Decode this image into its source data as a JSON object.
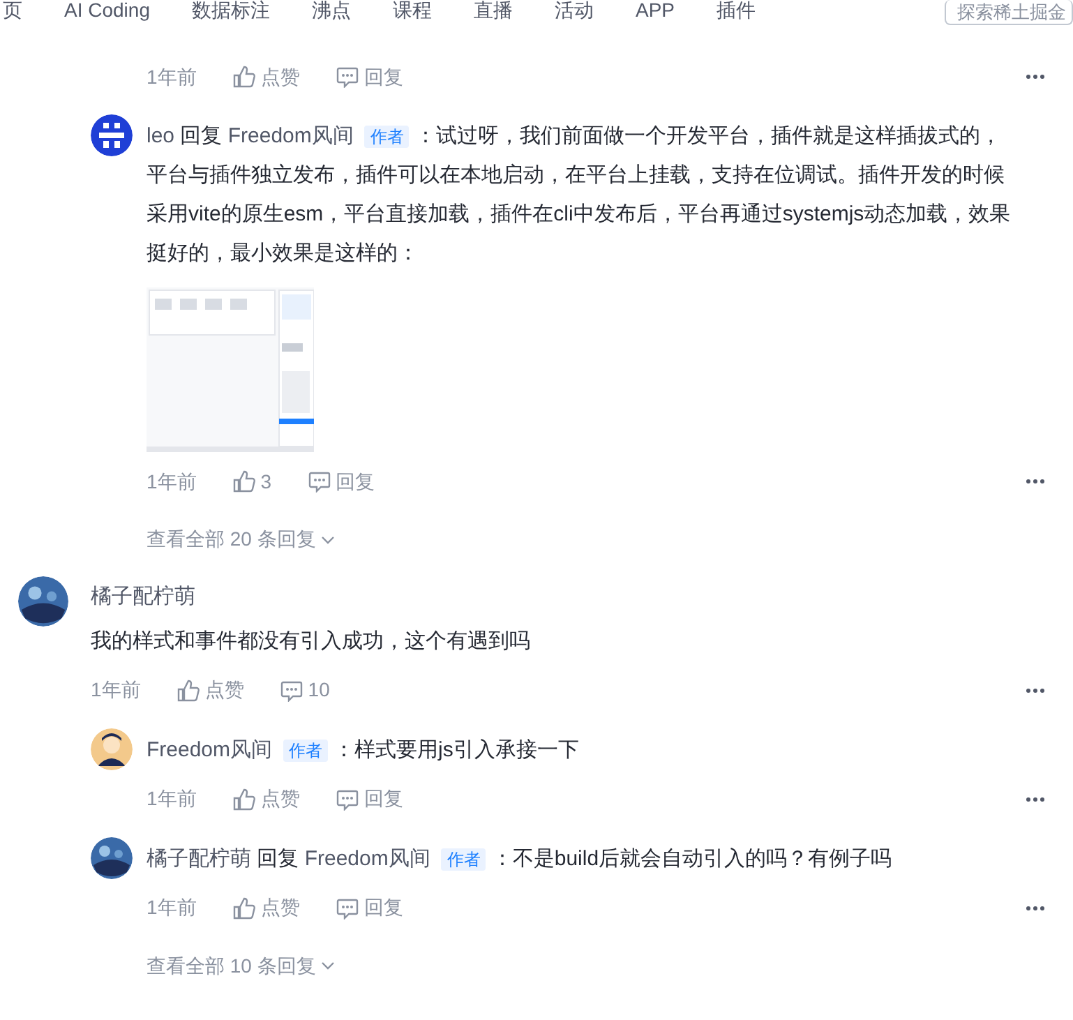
{
  "nav": {
    "items": [
      "页",
      "AI Coding",
      "数据标注",
      "沸点",
      "课程",
      "直播",
      "活动",
      "APP",
      "插件"
    ],
    "search": {
      "placeholder": "探索稀土掘金"
    }
  },
  "items": [
    {
      "kind": "reply",
      "actions": {
        "time": "1年前",
        "like": "点赞",
        "comment": "回复"
      }
    },
    {
      "kind": "reply",
      "avatar": {
        "kind": "pixel"
      },
      "author": "leo",
      "reply_label": "回复",
      "reply_to": "Freedom风间",
      "badge": "作者",
      "text": "：试过呀，我们前面做一个开发平台，插件就是这样插拔式的，平台与插件独立发布，插件可以在本地启动，在平台上挂载，支持在位调试。插件开发的时候采用vite的原生esm，平台直接加载，插件在cli中发布后，平台再通过systemjs动态加载，效果挺好的，最小效果是这样的：",
      "actions": {
        "time": "1年前",
        "like": "3",
        "comment": "回复"
      }
    },
    {
      "kind": "more",
      "text": "查看全部 20 条回复"
    },
    {
      "kind": "comment",
      "avatar": {
        "kind": "sky"
      },
      "author": "橘子配柠萌",
      "text": "我的样式和事件都没有引入成功，这个有遇到吗",
      "actions": {
        "time": "1年前",
        "like": "点赞",
        "comment": "10"
      }
    },
    {
      "kind": "reply",
      "avatar": {
        "kind": "figure"
      },
      "author": "Freedom风间",
      "badge": "作者",
      "text": "：样式要用js引入承接一下",
      "actions": {
        "time": "1年前",
        "like": "点赞",
        "comment": "回复"
      }
    },
    {
      "kind": "reply",
      "avatar": {
        "kind": "sky"
      },
      "author": "橘子配柠萌",
      "reply_label": "回复",
      "reply_to": "Freedom风间",
      "badge": "作者",
      "text": "：不是build后就会自动引入的吗？有例子吗",
      "actions": {
        "time": "1年前",
        "like": "点赞",
        "comment": "回复"
      }
    },
    {
      "kind": "more",
      "text": "查看全部 10 条回复"
    }
  ]
}
